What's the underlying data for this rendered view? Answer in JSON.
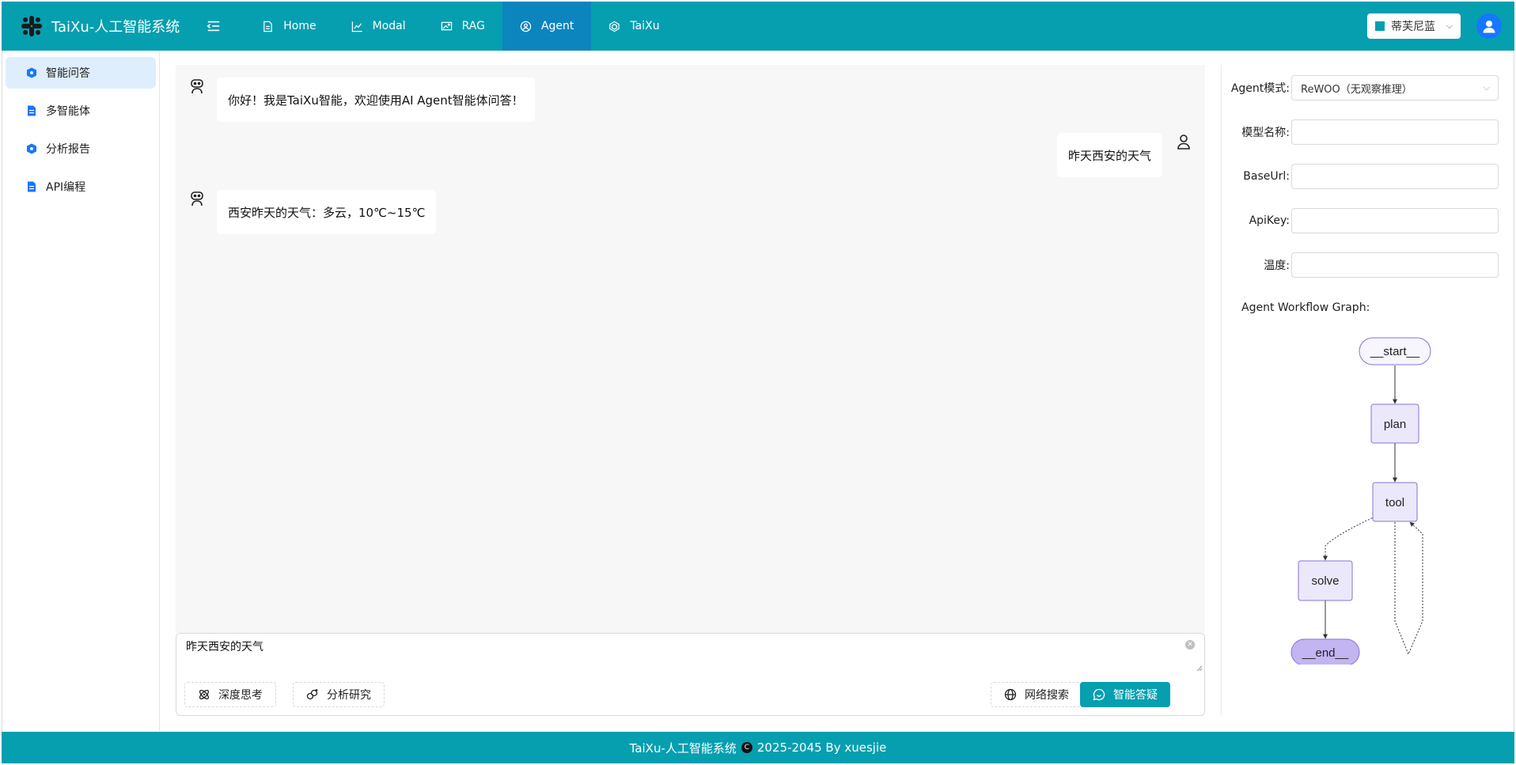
{
  "header": {
    "app_title": "TaiXu-人工智能系统",
    "nav": [
      {
        "label": "Home",
        "icon": "file-icon"
      },
      {
        "label": "Modal",
        "icon": "chart-icon"
      },
      {
        "label": "RAG",
        "icon": "image-icon"
      },
      {
        "label": "Agent",
        "icon": "user-circle-icon",
        "active": true
      },
      {
        "label": "TaiXu",
        "icon": "hexagon-icon"
      }
    ],
    "theme": {
      "label": "蒂芙尼蓝",
      "color": "#059fb0"
    }
  },
  "sidebar": {
    "items": [
      {
        "label": "智能问答",
        "icon": "shield-icon",
        "active": true
      },
      {
        "label": "多智能体",
        "icon": "document-icon"
      },
      {
        "label": "分析报告",
        "icon": "shield-icon"
      },
      {
        "label": "API编程",
        "icon": "document-icon"
      }
    ]
  },
  "chat": {
    "messages": [
      {
        "role": "bot",
        "text": "你好！我是TaiXu智能，欢迎使用AI Agent智能体问答！"
      },
      {
        "role": "user",
        "text": "昨天西安的天气"
      },
      {
        "role": "bot",
        "text": "西安昨天的天气：多云，10℃~15℃"
      }
    ],
    "input_value": "昨天西安的天气",
    "buttons": {
      "deep_think": "深度思考",
      "analysis": "分析研究",
      "web_search": "网络搜索",
      "submit": "智能答疑"
    }
  },
  "settings": {
    "agent_mode_label": "Agent模式:",
    "agent_mode_value": "ReWOO（无观察推理）",
    "model_name_label": "模型名称:",
    "base_url_label": "BaseUrl:",
    "api_key_label": "ApiKey:",
    "temperature_label": "温度:",
    "graph_title": "Agent Workflow Graph:"
  },
  "workflow": {
    "nodes": {
      "start": "__start__",
      "plan": "plan",
      "tool": "tool",
      "solve": "solve",
      "end": "__end__"
    }
  },
  "footer": {
    "left": "TaiXu-人工智能系统",
    "right": "2025-2045 By xuesjie"
  },
  "colors": {
    "brand": "#059fb0",
    "active_nav": "#0c85bf",
    "sidebar_active": "#deeefc",
    "avatar": "#1677ff",
    "node_fill": "#ece8fb",
    "node_stroke": "#8a6fd8"
  }
}
